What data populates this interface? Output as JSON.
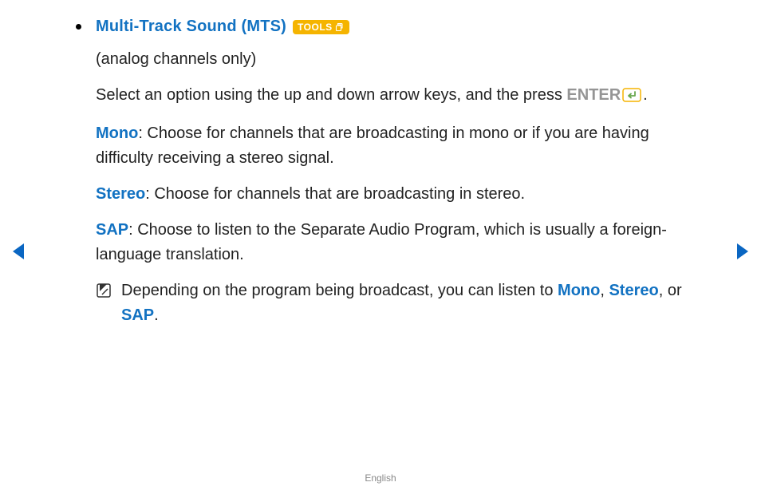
{
  "title": "Multi-Track Sound (MTS)",
  "tools_label": "TOOLS",
  "subtitle": "(analog channels only)",
  "instruction_prefix": "Select an option using the up and down arrow keys, and the press ",
  "enter_label": "ENTER",
  "instruction_suffix": ".",
  "mono_label": "Mono",
  "mono_text": ": Choose for channels that are broadcasting in mono or if you are having difficulty receiving a stereo signal.",
  "stereo_label": "Stereo",
  "stereo_text": ": Choose for channels that are broadcasting in stereo.",
  "sap_label": "SAP",
  "sap_text": ": Choose to listen to the Separate Audio Program, which is usually a foreign-language translation.",
  "note_prefix": "Depending on the program being broadcast, you can listen to ",
  "note_mono": "Mono",
  "note_sep1": ", ",
  "note_stereo": "Stereo",
  "note_sep2": ", or ",
  "note_sap": "SAP",
  "note_suffix": ".",
  "footer_lang": "English"
}
